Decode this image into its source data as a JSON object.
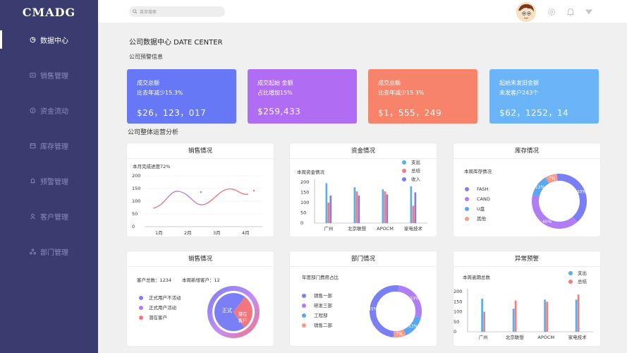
{
  "app": {
    "logo": "CMADG"
  },
  "sidebar": {
    "items": [
      {
        "label": "数据中心",
        "icon": "pie-icon",
        "active": true
      },
      {
        "label": "销售管理",
        "icon": "sales-icon",
        "active": false
      },
      {
        "label": "资金流动",
        "icon": "money-icon",
        "active": false
      },
      {
        "label": "库存管理",
        "icon": "inventory-icon",
        "active": false
      },
      {
        "label": "预警管理",
        "icon": "bell-icon",
        "active": false
      },
      {
        "label": "客户管理",
        "icon": "user-icon",
        "active": false
      },
      {
        "label": "部门管理",
        "icon": "dept-icon",
        "active": false
      }
    ]
  },
  "topbar": {
    "search_placeholder": "菜单搜索",
    "icons": [
      "avatar",
      "gear-icon",
      "bell-icon",
      "caret-down-icon"
    ]
  },
  "main": {
    "title": "公司数据中心  DATE  CENTER",
    "warning_section": "公司预警信息",
    "analysis_section": "公司整体运营分析"
  },
  "stats": [
    {
      "label": "成交总额",
      "sub": "比去年减少15.3%",
      "value": "$26，123，017",
      "color": "#6678f6"
    },
    {
      "label": "成交起始  金额",
      "sub": "占比增加15%",
      "value": "$259,433",
      "color": "#b06df3"
    },
    {
      "label": "成交总额",
      "sub": "比去年减少15.3%",
      "value": "$1，555，249",
      "color": "#f7836a"
    },
    {
      "label": "起始末发旧金额",
      "sub": "未发客户243个",
      "value": "$62，1252，14",
      "color": "#6cb4f8"
    }
  ],
  "cards": {
    "sales": {
      "title": "销售情况",
      "note": "本月完成进度72%",
      "chart_data": {
        "type": "line",
        "x": [
          "1月",
          "2月",
          "3月",
          "4月"
        ],
        "y_ticks": [
          0,
          50,
          100,
          150,
          200
        ],
        "ylim": [
          0,
          200
        ]
      }
    },
    "funds": {
      "title": "资金情况",
      "note": "本周资金情况",
      "legend": [
        "支出",
        "总结",
        "收入"
      ],
      "chart_data": {
        "type": "bar",
        "categories": [
          "广州",
          "北京联想",
          "APOCM",
          "家电技术"
        ],
        "y_ticks": [
          0,
          50,
          100,
          150,
          200
        ],
        "ylim": [
          0,
          200
        ],
        "series": [
          {
            "name": "支出",
            "values": [
              195,
              175,
              165,
              180
            ],
            "color": "#55b0ec"
          },
          {
            "name": "总结",
            "values": [
              100,
              155,
              155,
              85
            ],
            "color": "#f57c7c"
          },
          {
            "name": "收入",
            "values": [
              135,
              135,
              140,
              150
            ],
            "color": "#7b7df2"
          }
        ]
      }
    },
    "inventory": {
      "title": "库存情况",
      "note": "本周库存情况",
      "legend": [
        {
          "label": "FASH",
          "color": "#7b7ff5"
        },
        {
          "label": "CAND",
          "color": "#b07df4"
        },
        {
          "label": "U盘",
          "color": "#5aa7ef"
        },
        {
          "label": "其他",
          "color": "#f99a8a"
        }
      ],
      "chart_data": {
        "type": "pie",
        "labels": [
          "FASH",
          "CAND",
          "U盘",
          "其他"
        ],
        "values": [
          40,
          40,
          13,
          7
        ],
        "value_labels": [
          "40%",
          "40%",
          "13%",
          "7%"
        ]
      }
    },
    "sales2": {
      "title": "销售情况",
      "customers_label": "客户总数：1234",
      "new_label": "本周新增客户：12",
      "legend": [
        {
          "label": "正式用户不活动",
          "color": "#7b7ff5"
        },
        {
          "label": "正式用户活动",
          "color": "#b07df4"
        },
        {
          "label": "潜在客户",
          "color": "#f3757d"
        }
      ],
      "chart_data": {
        "type": "pie",
        "labels": [
          "正式",
          "潜在客户"
        ],
        "values": [
          70,
          30
        ]
      }
    },
    "dept": {
      "title": "部门情况",
      "note": "年度部门费用占比",
      "legend": [
        {
          "label": "销售一部",
          "color": "#7b7ff5"
        },
        {
          "label": "研发三部",
          "color": "#b07df4"
        },
        {
          "label": "工程部",
          "color": "#5aa7ef"
        },
        {
          "label": "销售二部",
          "color": "#f99a8a"
        }
      ],
      "chart_data": {
        "type": "pie",
        "labels": [
          "销售一部",
          "研发三部",
          "工程部",
          "销售二部"
        ],
        "values": [
          45,
          24,
          13,
          7
        ],
        "value_labels": [
          "45%",
          "24%",
          "13%",
          "7%"
        ]
      }
    },
    "alert": {
      "title": "异常预警",
      "note": "本周逾期总数",
      "legend": [
        "支出",
        "总结"
      ],
      "chart_data": {
        "type": "bar",
        "categories": [
          "广州",
          "北京联想",
          "APOCM",
          "家电技术"
        ],
        "y_ticks": [
          0,
          50,
          100,
          150,
          200
        ],
        "ylim": [
          0,
          200
        ],
        "series": [
          {
            "name": "支出",
            "values": [
              165,
              115,
              160,
              160
            ],
            "color": "#55b0ec"
          },
          {
            "name": "总结",
            "values": [
              100,
              155,
              150,
              185
            ],
            "color": "#f57c7c"
          }
        ]
      }
    }
  }
}
